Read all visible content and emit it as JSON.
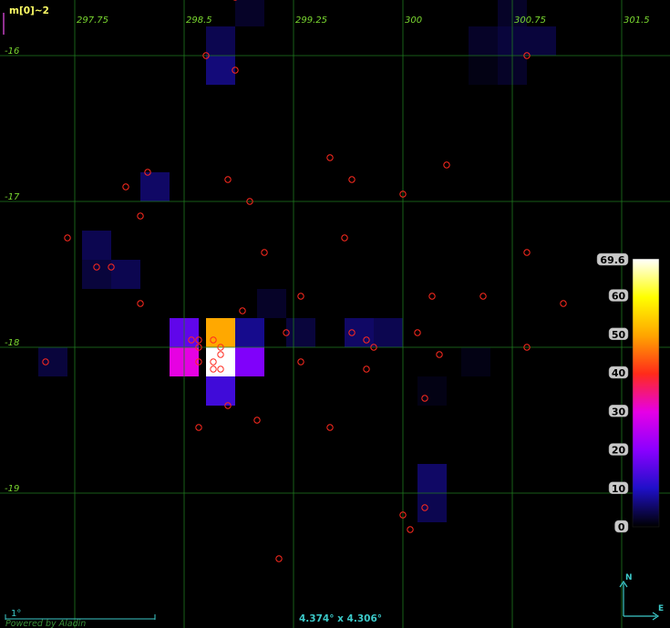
{
  "layer": {
    "name": "m[0]~2",
    "name_color": "#ffff66"
  },
  "grid": {
    "ra_labels": [
      "297.75",
      "298.5",
      "299.25",
      "300",
      "300.75",
      "301.5"
    ],
    "dec_labels": [
      "-16",
      "-17",
      "-18",
      "-19"
    ],
    "color": "#1f7a1f",
    "label_color": "#7ad830"
  },
  "hud": {
    "scale_label": "1°",
    "fov": "4.374° x 4.306°",
    "credit": "Powered by Aladin",
    "compass_north": "N",
    "compass_east": "E",
    "hud_color": "#3cc9c9"
  },
  "colorbar": {
    "max_label": "69.6",
    "tick_labels": [
      "60",
      "50",
      "40",
      "30",
      "20",
      "10",
      "0"
    ],
    "max_value": 69.6,
    "tick_values": [
      60,
      50,
      40,
      30,
      20,
      10,
      0
    ],
    "colormap": [
      "#ffffff",
      "#ffff00",
      "#ffa500",
      "#ff2b1a",
      "#e600e6",
      "#8a00ff",
      "#1f10c8",
      "#000000"
    ]
  },
  "map_data": {
    "cell_values": [
      {
        "ra": 298.75,
        "dec": -17.9,
        "value": 50
      },
      {
        "ra": 298.5,
        "dec": -17.9,
        "value": 16
      },
      {
        "ra": 298.95,
        "dec": -17.9,
        "value": 7
      },
      {
        "ra": 298.5,
        "dec": -18.1,
        "value": 30
      },
      {
        "ra": 298.75,
        "dec": -18.1,
        "value": 69.6
      },
      {
        "ra": 298.95,
        "dec": -18.1,
        "value": 19
      },
      {
        "ra": 298.75,
        "dec": -18.3,
        "value": 13
      },
      {
        "ra": 298.75,
        "dec": -16.1,
        "value": 6
      },
      {
        "ra": 298.75,
        "dec": -15.9,
        "value": 4
      },
      {
        "ra": 298.95,
        "dec": -15.7,
        "value": 2
      },
      {
        "ra": 300.55,
        "dec": -15.9,
        "value": 2
      },
      {
        "ra": 300.75,
        "dec": -15.9,
        "value": 3
      },
      {
        "ra": 300.95,
        "dec": -15.9,
        "value": 3
      },
      {
        "ra": 300.75,
        "dec": -15.7,
        "value": 2
      },
      {
        "ra": 300.55,
        "dec": -16.1,
        "value": 1
      },
      {
        "ra": 300.75,
        "dec": -16.1,
        "value": 2
      },
      {
        "ra": 298.3,
        "dec": -16.9,
        "value": 5
      },
      {
        "ra": 297.9,
        "dec": -17.3,
        "value": 4
      },
      {
        "ra": 297.9,
        "dec": -17.5,
        "value": 3
      },
      {
        "ra": 298.1,
        "dec": -17.5,
        "value": 4
      },
      {
        "ra": 299.1,
        "dec": -17.7,
        "value": 2
      },
      {
        "ra": 299.3,
        "dec": -17.9,
        "value": 3
      },
      {
        "ra": 299.7,
        "dec": -17.9,
        "value": 5
      },
      {
        "ra": 299.9,
        "dec": -17.9,
        "value": 4
      },
      {
        "ra": 297.6,
        "dec": -18.1,
        "value": 3
      },
      {
        "ra": 300.2,
        "dec": -18.9,
        "value": 5
      },
      {
        "ra": 300.2,
        "dec": -19.1,
        "value": 4
      },
      {
        "ra": 300.2,
        "dec": -18.3,
        "value": 1
      },
      {
        "ra": 300.5,
        "dec": -18.1,
        "value": 1
      }
    ],
    "sources": [
      {
        "ra": 298.85,
        "dec": -15.6
      },
      {
        "ra": 298.65,
        "dec": -16.0
      },
      {
        "ra": 298.85,
        "dec": -16.1
      },
      {
        "ra": 300.85,
        "dec": -16.0
      },
      {
        "ra": 299.5,
        "dec": -16.7
      },
      {
        "ra": 300.3,
        "dec": -16.75
      },
      {
        "ra": 298.25,
        "dec": -16.8
      },
      {
        "ra": 299.65,
        "dec": -16.85
      },
      {
        "ra": 298.8,
        "dec": -16.85
      },
      {
        "ra": 298.1,
        "dec": -16.9
      },
      {
        "ra": 300.0,
        "dec": -16.95
      },
      {
        "ra": 298.95,
        "dec": -17.0
      },
      {
        "ra": 298.2,
        "dec": -17.1
      },
      {
        "ra": 297.7,
        "dec": -17.25
      },
      {
        "ra": 299.6,
        "dec": -17.25
      },
      {
        "ra": 299.05,
        "dec": -17.35
      },
      {
        "ra": 300.85,
        "dec": -17.35
      },
      {
        "ra": 297.9,
        "dec": -17.45
      },
      {
        "ra": 298.0,
        "dec": -17.45
      },
      {
        "ra": 300.2,
        "dec": -17.65
      },
      {
        "ra": 300.55,
        "dec": -17.65
      },
      {
        "ra": 301.1,
        "dec": -17.7
      },
      {
        "ra": 299.3,
        "dec": -17.65
      },
      {
        "ra": 298.2,
        "dec": -17.7
      },
      {
        "ra": 298.9,
        "dec": -17.75
      },
      {
        "ra": 299.2,
        "dec": -17.9
      },
      {
        "ra": 299.65,
        "dec": -17.9
      },
      {
        "ra": 300.1,
        "dec": -17.9
      },
      {
        "ra": 298.55,
        "dec": -17.95
      },
      {
        "ra": 298.6,
        "dec": -17.95
      },
      {
        "ra": 298.7,
        "dec": -17.95
      },
      {
        "ra": 299.75,
        "dec": -17.95
      },
      {
        "ra": 299.8,
        "dec": -18.0
      },
      {
        "ra": 298.6,
        "dec": -18.0
      },
      {
        "ra": 298.75,
        "dec": -18.0
      },
      {
        "ra": 300.85,
        "dec": -18.0
      },
      {
        "ra": 300.25,
        "dec": -18.05
      },
      {
        "ra": 298.75,
        "dec": -18.05
      },
      {
        "ra": 298.6,
        "dec": -18.1
      },
      {
        "ra": 298.7,
        "dec": -18.1
      },
      {
        "ra": 299.3,
        "dec": -18.1
      },
      {
        "ra": 299.75,
        "dec": -18.15
      },
      {
        "ra": 297.55,
        "dec": -18.1
      },
      {
        "ra": 298.7,
        "dec": -18.15
      },
      {
        "ra": 298.75,
        "dec": -18.15
      },
      {
        "ra": 300.15,
        "dec": -18.35
      },
      {
        "ra": 298.8,
        "dec": -18.4
      },
      {
        "ra": 299.0,
        "dec": -18.5
      },
      {
        "ra": 298.6,
        "dec": -18.55
      },
      {
        "ra": 299.5,
        "dec": -18.55
      },
      {
        "ra": 300.15,
        "dec": -19.1
      },
      {
        "ra": 300.0,
        "dec": -19.15
      },
      {
        "ra": 300.05,
        "dec": -19.25
      },
      {
        "ra": 299.15,
        "dec": -19.45
      }
    ],
    "source_color": "#ff2a1f"
  }
}
